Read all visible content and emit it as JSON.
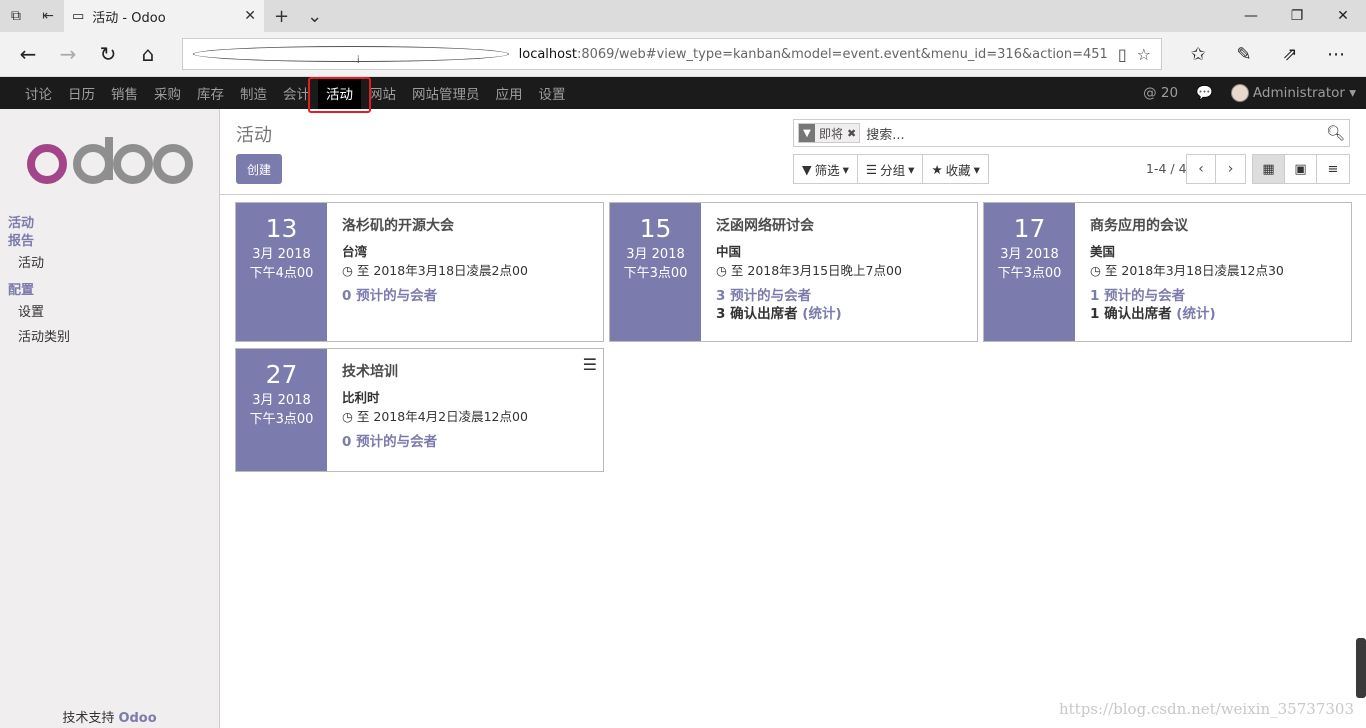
{
  "browser": {
    "tab_title": "活动 - Odoo",
    "url_host": "localhost",
    "url_rest": ":8069/web#view_type=kanban&model=event.event&menu_id=316&action=451"
  },
  "topmenu": {
    "items": [
      "讨论",
      "日历",
      "销售",
      "采购",
      "库存",
      "制造",
      "会计",
      "活动",
      "网站",
      "网站管理员",
      "应用",
      "设置"
    ],
    "active": "活动",
    "notifications": "@ 20",
    "user": "Administrator"
  },
  "sidebar": {
    "section1": "活动",
    "section2": "报告",
    "link1": "活动",
    "section3": "配置",
    "link2": "设置",
    "link3": "活动类别",
    "footer_text": "技术支持 ",
    "footer_brand": "Odoo"
  },
  "controlpanel": {
    "breadcrumb": "活动",
    "create_label": "创建",
    "facet": "即将",
    "search_placeholder": "搜索...",
    "filters_label": "筛选",
    "groupby_label": "分组",
    "favorites_label": "收藏",
    "pager": "1-4 / 4"
  },
  "events": [
    {
      "day": "13",
      "month_year": "3月 2018",
      "time": "下午4点00",
      "name": "洛杉矶的开源大会",
      "location": "台湾",
      "end": "至 2018年3月18日凌晨2点00",
      "expected": "0 预计的与会者",
      "confirmed": ""
    },
    {
      "day": "15",
      "month_year": "3月 2018",
      "time": "下午3点00",
      "name": "泛函网络研讨会",
      "location": "中国",
      "end": "至 2018年3月15日晚上7点00",
      "expected": "3 预计的与会者",
      "confirmed": "3 确认出席者 ",
      "stats": "(统计)"
    },
    {
      "day": "17",
      "month_year": "3月 2018",
      "time": "下午3点00",
      "name": "商务应用的会议",
      "location": "美国",
      "end": "至 2018年3月18日凌晨12点30",
      "expected": "1 预计的与会者",
      "confirmed": "1 确认出席者 ",
      "stats": "(统计)"
    },
    {
      "day": "27",
      "month_year": "3月 2018",
      "time": "下午3点00",
      "name": "技术培训",
      "location": "比利时",
      "end": "至 2018年4月2日凌晨12点00",
      "expected": "0 预计的与会者",
      "confirmed": ""
    }
  ],
  "watermark": "https://blog.csdn.net/weixin_35737303"
}
